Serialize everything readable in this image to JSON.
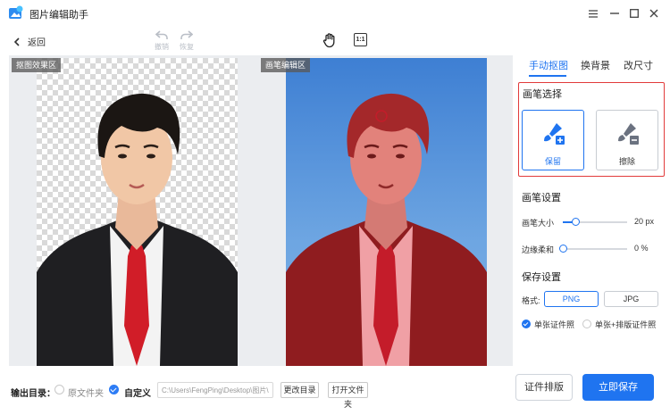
{
  "app": {
    "title": "图片编辑助手"
  },
  "toolbar": {
    "back_label": "返回",
    "undo_label": "撤销",
    "redo_label": "恢复",
    "fit_label": "1:1"
  },
  "canvas": {
    "left_tag": "抠图效果区",
    "right_tag": "画笔编辑区"
  },
  "tabs": [
    {
      "label": "手动抠图",
      "active": true
    },
    {
      "label": "换背景",
      "active": false
    },
    {
      "label": "改尺寸",
      "active": false
    }
  ],
  "brush_select": {
    "title": "画笔选择",
    "keep_label": "保留",
    "erase_label": "擦除"
  },
  "brush_settings": {
    "title": "画笔设置",
    "size_label": "画笔大小",
    "size_value": "20 px",
    "size_fraction": 0.2,
    "feather_label": "边缘柔和",
    "feather_value": "0 %",
    "feather_fraction": 0.0
  },
  "save_settings": {
    "title": "保存设置",
    "format_label": "格式:",
    "formats": [
      "PNG",
      "JPG"
    ],
    "selected_format": "PNG",
    "single_label": "单张证件照",
    "single_checked": true,
    "combo_label": "单张+排版证件照",
    "combo_checked": false
  },
  "bottom": {
    "output_label": "输出目录：",
    "opt_original": "原文件夹",
    "opt_custom": "自定义",
    "path_value": "C:\\Users\\FengPing\\Desktop\\图片\\",
    "change_dir": "更改目录",
    "open_folder": "打开文件夹",
    "layout_button": "证件排版",
    "save_button": "立即保存"
  },
  "colors": {
    "accent": "#1f74f0",
    "highlight_border": "#e23b3b",
    "mask_red": "#e23b3b"
  }
}
